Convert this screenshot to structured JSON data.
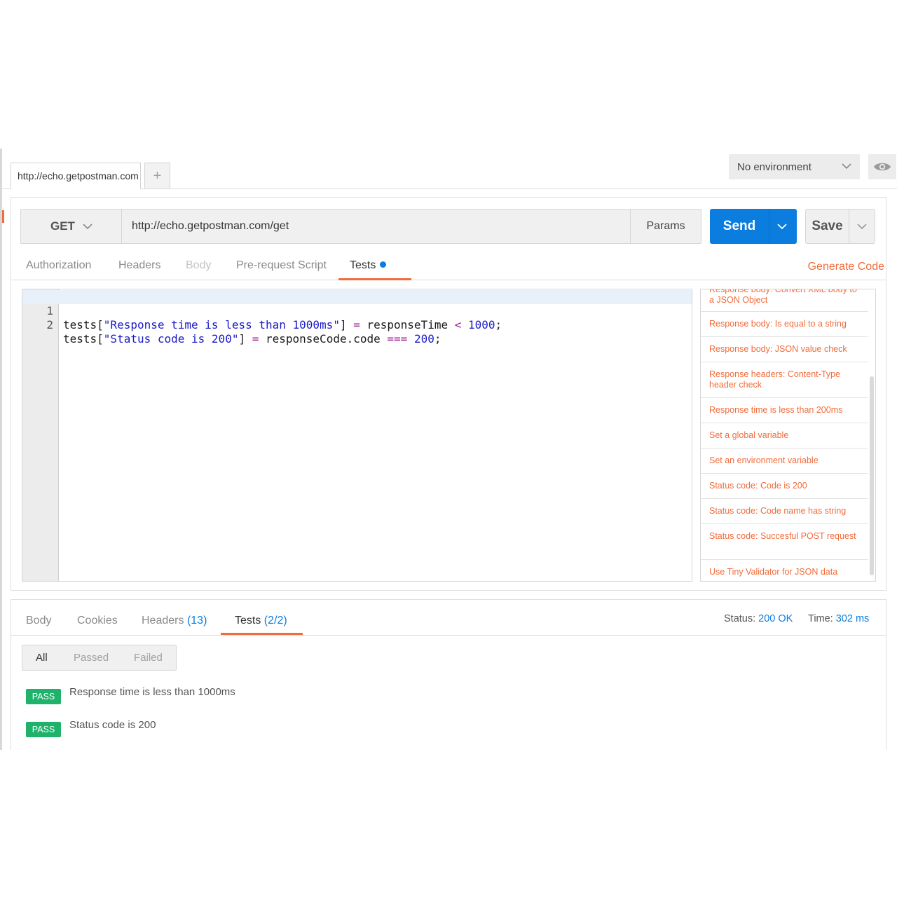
{
  "tabs": {
    "request_tab_url": "http://echo.getpostman.com",
    "add_label": "+"
  },
  "environment": {
    "selected": "No environment"
  },
  "request": {
    "method": "GET",
    "url": "http://echo.getpostman.com/get",
    "params_label": "Params",
    "send_label": "Send",
    "save_label": "Save"
  },
  "request_tabs": {
    "items": [
      "Authorization",
      "Headers",
      "Body",
      "Pre-request Script",
      "Tests"
    ],
    "active": "Tests",
    "generate_code": "Generate Code"
  },
  "editor": {
    "lines": [
      {
        "num": "1",
        "p1": "tests[",
        "s1": "\"Response time is less than 1000ms\"",
        "p2": "] ",
        "op1": "=",
        "p3": " responseTime ",
        "op2": "<",
        "p4": " ",
        "n1": "1000",
        "p5": ";"
      },
      {
        "num": "2",
        "p1": "tests[",
        "s1": "\"Status code is 200\"",
        "p2": "] ",
        "op1": "=",
        "p3": " responseCode.code ",
        "op2": "===",
        "p4": " ",
        "n1": "200",
        "p5": ";"
      }
    ]
  },
  "snippets": [
    "Response body: Convert XML body to a JSON Object",
    "Response body: Is equal to a string",
    "Response body: JSON value check",
    "Response headers: Content-Type header check",
    "Response time is less than 200ms",
    "Set a global variable",
    "Set an environment variable",
    "Status code: Code is 200",
    "Status code: Code name has string",
    "Status code: Succesful POST request",
    "Use Tiny Validator for JSON data"
  ],
  "response": {
    "tabs": {
      "body": "Body",
      "cookies": "Cookies",
      "headers": "Headers",
      "headers_count": "(13)",
      "tests": "Tests",
      "tests_count": "(2/2)"
    },
    "status_label": "Status:",
    "status_value": "200 OK",
    "time_label": "Time:",
    "time_value": "302 ms",
    "filters": [
      "All",
      "Passed",
      "Failed"
    ],
    "results": [
      {
        "badge": "PASS",
        "text": "Response time is less than 1000ms"
      },
      {
        "badge": "PASS",
        "text": "Status code is 200"
      }
    ]
  },
  "colors": {
    "accent_orange": "#f26b3a",
    "send_blue": "#0b7ddf",
    "pass_green": "#1fb26b"
  }
}
